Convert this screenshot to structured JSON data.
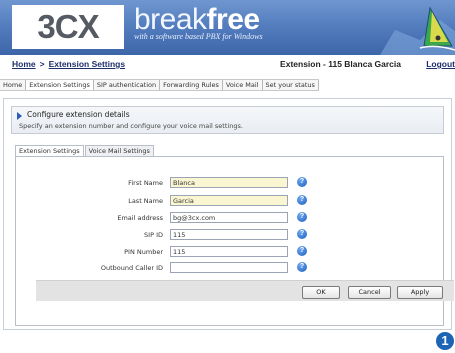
{
  "banner": {
    "logo": "3CX",
    "tagline_light": "break",
    "tagline_bold": "free",
    "tagline_small": "with a software based PBX for Windows"
  },
  "header": {
    "home": "Home",
    "separator": ">",
    "extension_settings": "Extension Settings",
    "title": "Extension - 115 Blanca Garcia",
    "logout": "Logout"
  },
  "topnav": {
    "items": [
      {
        "label": "Home"
      },
      {
        "label": "Extension Settings"
      },
      {
        "label": "SIP authentication"
      },
      {
        "label": "Forwarding Rules"
      },
      {
        "label": "Voice Mail"
      },
      {
        "label": "Set your status"
      }
    ]
  },
  "config": {
    "title": "Configure extension details",
    "subtitle": "Specify an extension number and configure your voice mail settings."
  },
  "subtabs": {
    "items": [
      {
        "label": "Extension Settings"
      },
      {
        "label": "Voice Mail Settings"
      }
    ]
  },
  "form": {
    "help_icon": "question-circle-icon",
    "help_glyph": "?",
    "fields": [
      {
        "label": "First Name",
        "value": "Blanca"
      },
      {
        "label": "Last Name",
        "value": "Garcia"
      },
      {
        "label": "Email address",
        "value": "bg@3cx.com"
      },
      {
        "label": "SIP ID",
        "value": "115"
      },
      {
        "label": "PIN Number",
        "value": "115"
      },
      {
        "label": "Outbound Caller ID",
        "value": ""
      }
    ]
  },
  "buttons": {
    "ok": "OK",
    "cancel": "Cancel",
    "apply": "Apply"
  },
  "badge": "1",
  "colors": {
    "banner": "#4f79bb",
    "link": "#1d2f6b",
    "filled_input": "#fbf6d2",
    "help": "#1f5fc0",
    "badge": "#1e64b4"
  }
}
